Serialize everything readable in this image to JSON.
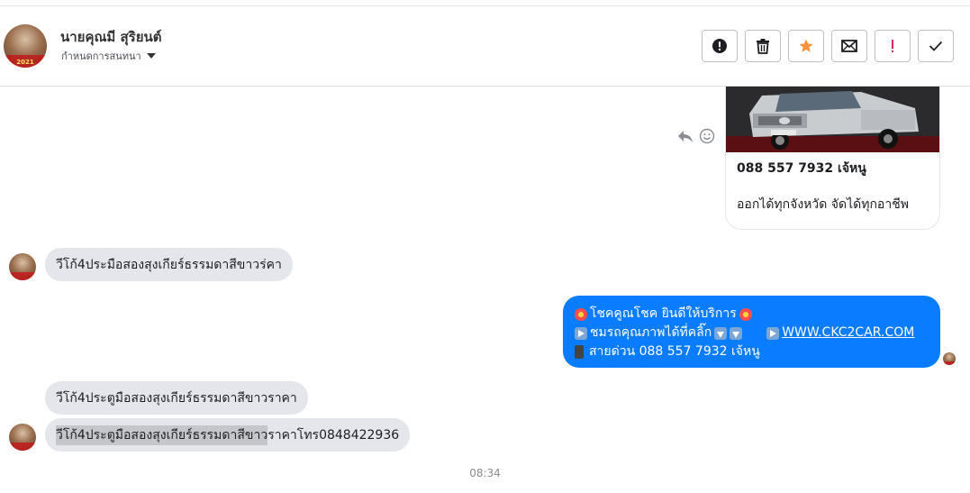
{
  "header": {
    "contact_name": "นายคุณมี สุริยนต์",
    "subtitle": "กำหนดการสนทนา",
    "avatar_year": "2021",
    "actions": [
      {
        "name": "mark-spam-button",
        "icon": "exclamation-circle-icon"
      },
      {
        "name": "delete-button",
        "icon": "trash-icon"
      },
      {
        "name": "star-button",
        "icon": "star-icon",
        "color": "#f7923a"
      },
      {
        "name": "mark-unread-button",
        "icon": "envelope-icon"
      },
      {
        "name": "priority-button",
        "icon": "exclamation-icon",
        "color": "#e0245e"
      },
      {
        "name": "mark-done-button",
        "icon": "check-icon"
      }
    ]
  },
  "messages": {
    "card": {
      "title": "088 557 7932 เจ้หนู",
      "description": "ออกได้ทุกจังหวัด จัดได้ทุกอาชีพ"
    },
    "incoming_1": "วีโก้4ประมือสองสุงเกียร์ธรรมดาสีขาวร่คา",
    "outgoing": {
      "line1": "โชคคูณโชค ยินดีให้บริการ",
      "line2": "ชมรถคุณภาพได้ที่คลิ๊ก",
      "link": "WWW.CKC2CAR.COM",
      "line3": "สายด่วน 088 557 7932 เจ้หนู"
    },
    "incoming_2": "วีโก้4ประตูมือสองสุงเกียร์ธรรมดาสีขาวราคา",
    "incoming_3_highlight": "วีโก้4ประตูมือสองสุงเกียร์ธรรมดาสีขาว",
    "incoming_3_rest": "ราคาโทร0848422936",
    "timestamp": "08:34"
  },
  "colors": {
    "outgoing_bubble": "#0a7cff",
    "incoming_bubble": "#e4e6eb"
  }
}
